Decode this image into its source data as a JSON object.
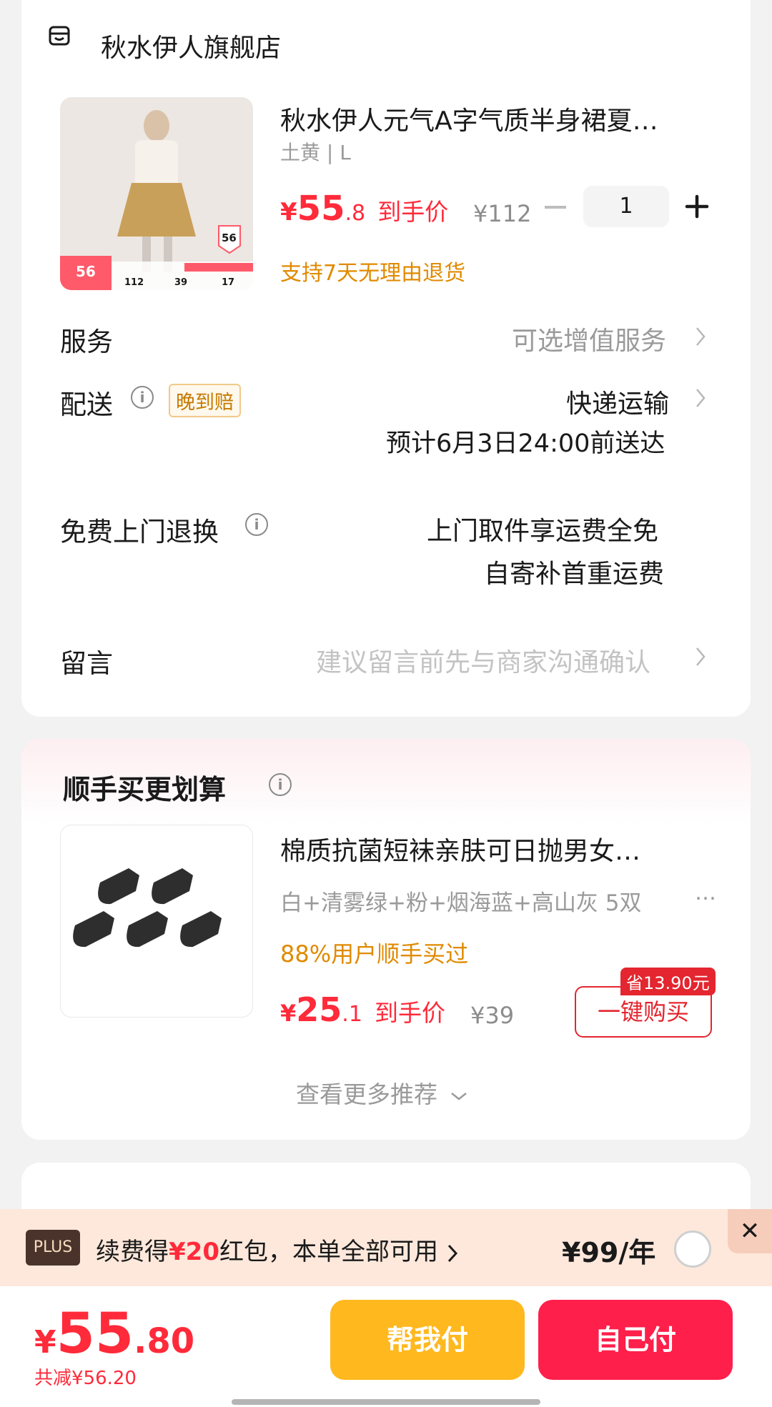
{
  "store": {
    "name": "秋水伊人旗舰店",
    "icon": "store-icon"
  },
  "product": {
    "title": "秋水伊人元气A字气质半身裙夏…",
    "spec": "土黄 | L",
    "price_symbol": "¥",
    "price_int": "55",
    "price_dec": ".8",
    "price_label": "到手价",
    "original_price": "¥112",
    "quantity": "1",
    "return_policy": "支持7天无理由退货",
    "thumb_badge_left": "56",
    "thumb_badge_right": "56",
    "thumb_stats": [
      "112",
      "39",
      "17"
    ]
  },
  "rows": {
    "service_label": "服务",
    "service_value": "可选增值服务",
    "delivery_label": "配送",
    "late_badge": "晚到赔",
    "delivery_value": "快递运输",
    "delivery_eta": "预计6月3日24:00前送达",
    "return_label": "免费上门退换",
    "return_line1": "上门取件享运费全免",
    "return_line2": "自寄补首重运费",
    "message_label": "留言",
    "message_placeholder": "建议留言前先与商家沟通确认"
  },
  "addon": {
    "section_title": "顺手买更划算",
    "title": "棉质抗菌短袜亲肤可日抛男女…",
    "spec": "白+清雾绿+粉+烟海蓝+高山灰 5双",
    "more": "…",
    "social_proof": "88%用户顺手买过",
    "price_symbol": "¥",
    "price_int": "25",
    "price_dec": ".1",
    "price_label": "到手价",
    "original_price": "¥39",
    "save_badge": "省13.90元",
    "buy_button": "一键购买",
    "see_more": "查看更多推荐"
  },
  "plus": {
    "logo": "PLUS",
    "text_pre": "续费得",
    "text_amount": "¥20",
    "text_post": "红包，本单全部可用",
    "price": "¥99/年"
  },
  "bottom": {
    "price_symbol": "¥",
    "price_int": "55",
    "price_dec": ".80",
    "discount": "共减¥56.20",
    "help_pay": "帮我付",
    "self_pay": "自己付"
  },
  "colors": {
    "accent_red": "#ff2a3a",
    "orange": "#e08a00",
    "yellow_button": "#ffb81e",
    "red_button": "#ff1f4b"
  }
}
